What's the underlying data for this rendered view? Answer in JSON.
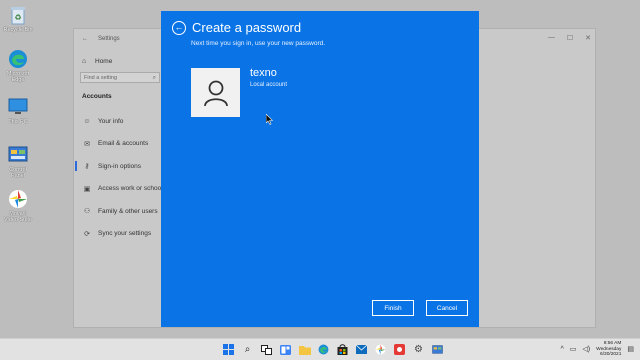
{
  "desktop": {
    "icons": [
      {
        "label": "Recycle Bin",
        "icon": "recycle-bin-icon"
      },
      {
        "label": "Microsoft Edge",
        "icon": "edge-icon"
      },
      {
        "label": "This PC",
        "icon": "monitor-icon"
      },
      {
        "label": "Control Panel",
        "icon": "control-panel-icon"
      },
      {
        "label": "Movavi Video Suite",
        "icon": "movavi-icon"
      }
    ]
  },
  "settings": {
    "title": "Settings",
    "home_label": "Home",
    "search_placeholder": "Find a setting",
    "section": "Accounts",
    "nav": [
      {
        "label": "Your info",
        "icon": "person-icon"
      },
      {
        "label": "Email & accounts",
        "icon": "mail-icon"
      },
      {
        "label": "Sign-in options",
        "icon": "key-icon"
      },
      {
        "label": "Access work or school",
        "icon": "briefcase-icon"
      },
      {
        "label": "Family & other users",
        "icon": "people-icon"
      },
      {
        "label": "Sync your settings",
        "icon": "sync-icon"
      }
    ]
  },
  "dialog": {
    "title": "Create a password",
    "subtitle": "Next time you sign in, use your new password.",
    "username": "texno",
    "account_type": "Local account",
    "finish_label": "Finish",
    "cancel_label": "Cancel"
  },
  "taskbar": {
    "time": "8:56 AM",
    "day": "Wednesday",
    "date": "6/30/2021"
  },
  "colors": {
    "dialog_bg": "#0a74e6",
    "accent": "#2a6ad9"
  }
}
